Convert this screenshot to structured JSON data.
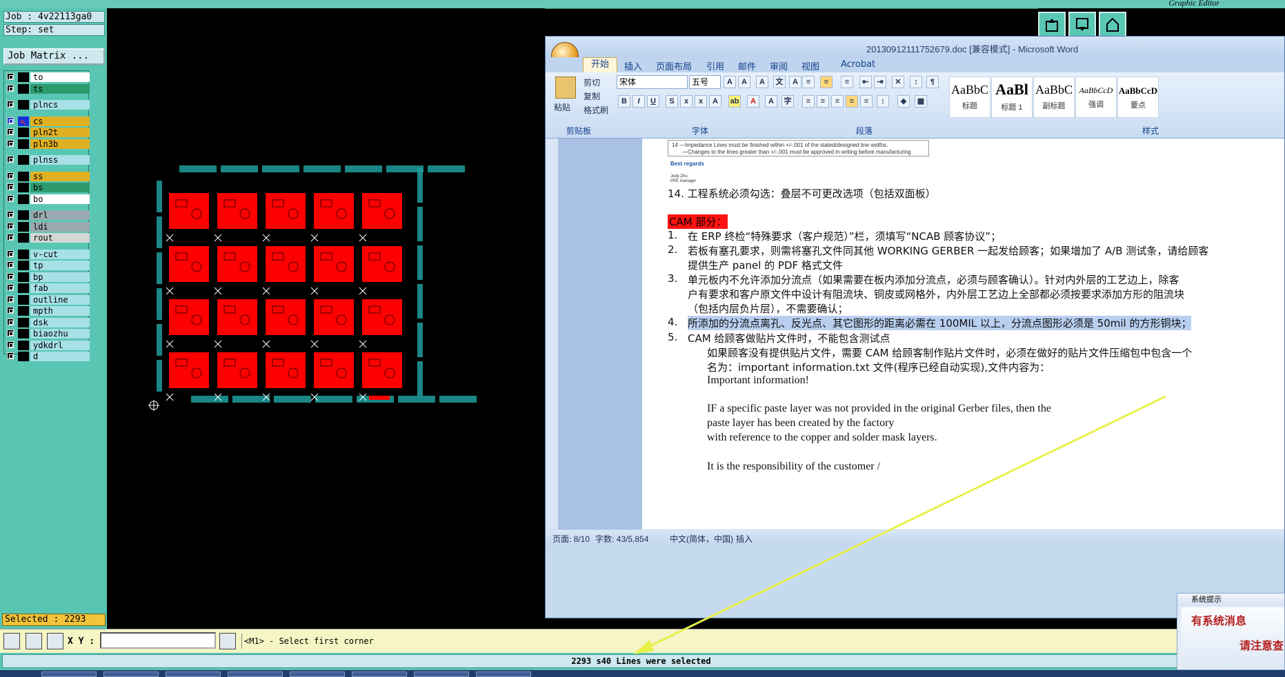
{
  "genesis": {
    "title": "Graphic Editor",
    "job_label": "Job : 4v22113ga0",
    "step_label": "Step: set",
    "job_matrix_label": "Job Matrix ...",
    "selected_label": "Selected : 2293",
    "xy_label": "X Y :",
    "xy_value": "",
    "command_prompt": "<M1> - Select first corner",
    "status_message": "2293 s40 Lines were selected",
    "layers": [
      {
        "name": "to",
        "color": "#ffffff",
        "group": 0
      },
      {
        "name": "ts",
        "color": "#2e9b6f",
        "group": 0
      },
      {
        "name": "plncs",
        "color": "#a7e0e6",
        "group": 1
      },
      {
        "name": "cs",
        "color": "#e0b024",
        "group": 2,
        "active": true
      },
      {
        "name": "pln2t",
        "color": "#e0b024",
        "group": 2
      },
      {
        "name": "pln3b",
        "color": "#e0b024",
        "group": 2
      },
      {
        "name": "plnss",
        "color": "#a7e0e6",
        "group": 3
      },
      {
        "name": "ss",
        "color": "#e0b024",
        "group": 4
      },
      {
        "name": "bs",
        "color": "#2e9b6f",
        "group": 4
      },
      {
        "name": "bo",
        "color": "#ffffff",
        "group": 4
      },
      {
        "name": "drl",
        "color": "#9aa9b0",
        "group": 5
      },
      {
        "name": "ldi",
        "color": "#9aa9b0",
        "group": 5
      },
      {
        "name": "rout",
        "color": "#d6d6d6",
        "group": 5
      },
      {
        "name": "v-cut",
        "color": "#a7e0e6",
        "group": 6
      },
      {
        "name": "tp",
        "color": "#a7e0e6",
        "group": 6
      },
      {
        "name": "bp",
        "color": "#a7e0e6",
        "group": 6
      },
      {
        "name": "fab",
        "color": "#a7e0e6",
        "group": 6
      },
      {
        "name": "outline",
        "color": "#a7e0e6",
        "group": 6
      },
      {
        "name": "mpth",
        "color": "#a7e0e6",
        "group": 6
      },
      {
        "name": "dsk",
        "color": "#a7e0e6",
        "group": 6
      },
      {
        "name": "biaozhu",
        "color": "#a7e0e6",
        "group": 6
      },
      {
        "name": "ydkdrl",
        "color": "#a7e0e6",
        "group": 6
      },
      {
        "name": "d",
        "color": "#a7e0e6",
        "group": 6
      }
    ]
  },
  "word": {
    "title": "20130912111752679.doc [兼容模式] - Microsoft Word",
    "tabs": [
      "开始",
      "插入",
      "页面布局",
      "引用",
      "邮件",
      "审阅",
      "视图",
      "Acrobat"
    ],
    "clipboard": {
      "paste": "粘贴",
      "cut": "剪切",
      "copy": "复制",
      "format_painter": "格式刷",
      "group": "剪贴板"
    },
    "font": {
      "name": "宋体",
      "size": "五号",
      "group": "字体"
    },
    "paragraph_group": "段落",
    "styles_group": "样式",
    "styles": [
      {
        "sample": "AaBbC",
        "name": "标题"
      },
      {
        "sample": "AaBl",
        "name": "标题 1"
      },
      {
        "sample": "AaBbC",
        "name": "副标题"
      },
      {
        "sample": "AaBbCcD",
        "name": "强调"
      },
      {
        "sample": "AaBbCcD",
        "name": "要点"
      }
    ],
    "doc": {
      "embedded_line1": "14  —Impedance Lines must be finished within +/-.001 of the stated/designed line widths.",
      "embedded_line2": "—Changes to the lines greater than +/-.001 must be approved in writing before manufacturing",
      "embedded_regards": "Best regards",
      "embedded_sig1": "Judy Zhu",
      "embedded_sig2": "PPE manager",
      "line14": "14. 工程系统必须勾选：叠层不可更改选项（包括双面板）",
      "cam_heading": "CAM 部分：",
      "items": [
        {
          "num": "1.",
          "text": "在 ERP 终检“特殊要求（客户规范）”栏，须填写“NCAB 顾客协议”；"
        },
        {
          "num": "2.",
          "text": "若板有塞孔要求，则需将塞孔文件同其他 WORKING GERBER 一起发给顾客；如果增加了 A/B 测试条，请给顾客"
        },
        {
          "num": "",
          "text": "提供生产 panel 的 PDF 格式文件"
        },
        {
          "num": "3.",
          "text": "单元板内不允许添加分流点（如果需要在板内添加分流点，必须与顾客确认）。针对内外层的工艺边上，除客"
        },
        {
          "num": "",
          "text": "户有要求和客户原文件中设计有阻流块、铜皮或网格外，内外层工艺边上全部都必须按要求添加方形的阻流块"
        },
        {
          "num": "",
          "text": "（包括内层负片层），不需要确认；"
        },
        {
          "num": "4.",
          "text": "所添加的分流点离孔、反光点、其它图形的距离必需在 100MIL 以上，分流点图形必须是 50mil 的方形铜块；"
        },
        {
          "num": "5.",
          "text": "CAM 给顾客做贴片文件时，不能包含测试点"
        }
      ],
      "sub1": "如果顾客没有提供贴片文件，需要 CAM 给顾客制作贴片文件时，必须在做好的贴片文件压缩包中包含一个",
      "sub2": "名为：important information.txt 文件(程序已经自动实现),文件内容为：",
      "eng1": "Important information!",
      "eng2": "IF a specific paste layer was not provided in the original Gerber files, then the",
      "eng3": "paste layer has been created by the factory",
      "eng4": "with reference to the copper and solder mask layers.",
      "eng5": "It is the responsibility of the customer /"
    },
    "status": {
      "page": "页面: 8/10",
      "words": "字数: 43/5,854",
      "lang": "中文(简体，中国)",
      "mode": "插入"
    }
  },
  "popup": {
    "title": "系统提示",
    "line1": "有系统消息",
    "line2": "请注意查"
  },
  "colors": {
    "copper": "#ff0000",
    "frame": "#1e9e9e",
    "accent": "#58c6b3",
    "selection": "#b9cff0"
  }
}
